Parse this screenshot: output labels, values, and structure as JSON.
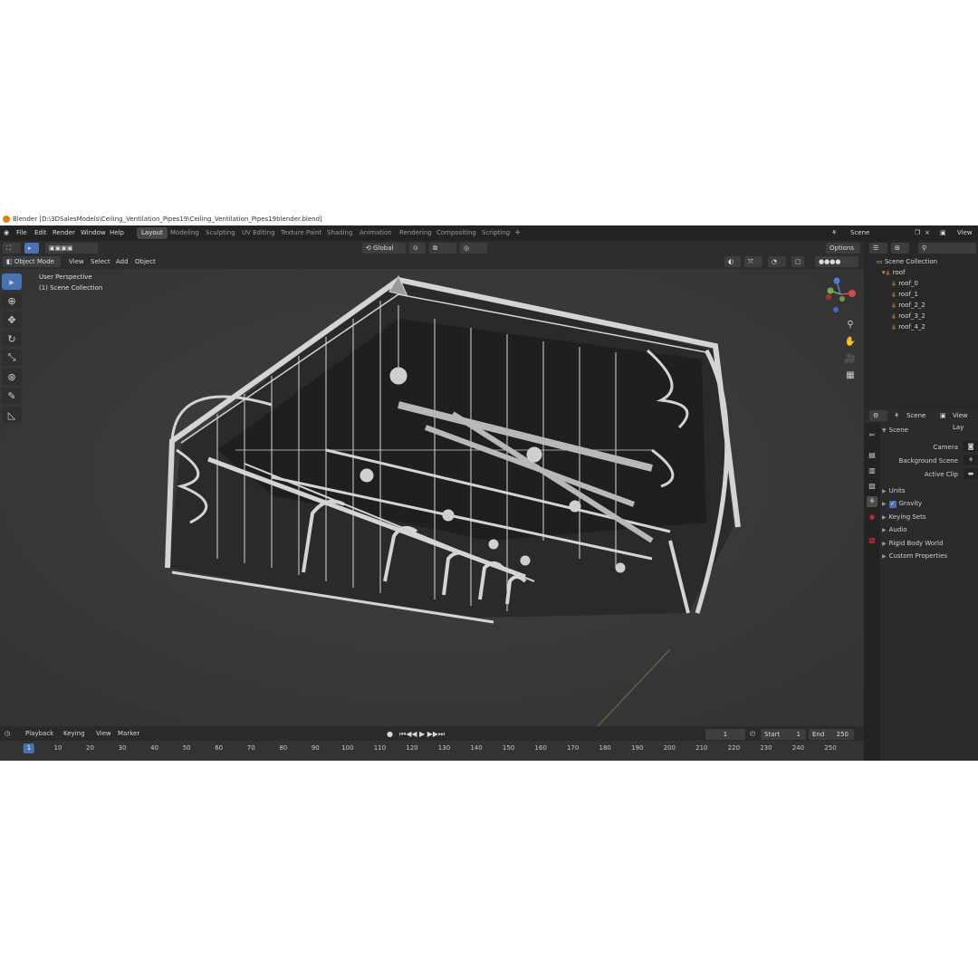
{
  "window": {
    "title": "Blender [D:\\3DSalesModels\\Ceiling_Ventilation_Pipes19\\Ceiling_Ventilation_Pipes19blender.blend]"
  },
  "menu": [
    "File",
    "Edit",
    "Render",
    "Window",
    "Help"
  ],
  "workspaces": [
    "Layout",
    "Modeling",
    "Sculpting",
    "UV Editing",
    "Texture Paint",
    "Shading",
    "Animation",
    "Rendering",
    "Compositing",
    "Scripting"
  ],
  "active_workspace": "Layout",
  "scene_selector": {
    "label": "Scene"
  },
  "view_layer_selector": {
    "label": "View La"
  },
  "toolbar": {
    "orientation": "Global",
    "options": "Options"
  },
  "viewport_header": {
    "mode": "Object Mode",
    "items": [
      "View",
      "Select",
      "Add",
      "Object"
    ]
  },
  "viewport": {
    "perspective": "User Perspective",
    "collection": "(1) Scene Collection"
  },
  "gizmo": {
    "x": "X",
    "y": "Y",
    "z": "Z"
  },
  "outliner": {
    "root": "Scene Collection",
    "parent": "roof",
    "children": [
      {
        "name": "roof_0",
        "badge": "2"
      },
      {
        "name": "roof_1",
        "badge": "2"
      },
      {
        "name": "roof_2_2",
        "badge": "2"
      },
      {
        "name": "roof_3_2",
        "badge": "2"
      },
      {
        "name": "roof_4_2",
        "badge": "3"
      }
    ]
  },
  "properties": {
    "header_scene": "Scene",
    "header_view_layer": "View Lay",
    "panel": "Scene",
    "fields": [
      {
        "label": "Camera"
      },
      {
        "label": "Background Scene"
      },
      {
        "label": "Active Clip"
      }
    ],
    "sections": [
      "Units",
      "Gravity",
      "Keying Sets",
      "Audio",
      "Rigid Body World",
      "Custom Properties"
    ],
    "gravity_checked": true
  },
  "timeline": {
    "menu": [
      "Playback",
      "Keying",
      "View",
      "Marker"
    ],
    "current_frame": "1",
    "start_label": "Start",
    "start": "1",
    "end_label": "End",
    "end": "250",
    "ticks": [
      "1",
      "10",
      "20",
      "30",
      "40",
      "50",
      "60",
      "70",
      "80",
      "90",
      "100",
      "110",
      "120",
      "130",
      "140",
      "150",
      "160",
      "170",
      "180",
      "190",
      "200",
      "210",
      "220",
      "230",
      "240",
      "250"
    ]
  }
}
